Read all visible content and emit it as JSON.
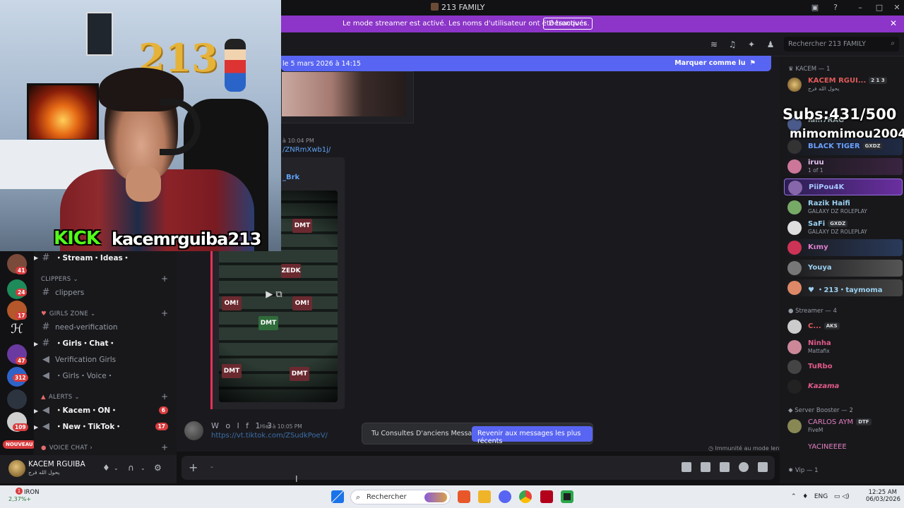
{
  "window": {
    "title": "213 FAMILY"
  },
  "banner": {
    "text": "Le mode streamer est activé. Les noms d'utilisateur ont été tronqués.",
    "button": "Désactiver"
  },
  "header": {
    "search_placeholder": "Rechercher 213 FAMILY"
  },
  "unread_bar": {
    "text": "le 5 mars 2026 à 14:15",
    "mark_read": "Marquer comme lu"
  },
  "messages": [
    {
      "timestamp": "à 10:04 PM",
      "link": "/ZNRmXwb1j/",
      "embed_author": "_Brk"
    },
    {
      "author": "W o l f 1 3",
      "timestamp": "Hier à 10:05 PM",
      "link": "https://vt.tiktok.com/ZSudkPoeV/"
    }
  ],
  "video_tiles": [
    "DMT",
    "ZEDK",
    "OM!",
    "DMT",
    "OM!",
    "DMT",
    "DMT"
  ],
  "toast": {
    "text": "Tu Consultes D'anciens Messages",
    "button": "Revenir aux messages les plus récents"
  },
  "slowmode": "Immunité au mode lent",
  "composer": {
    "placeholder": "-"
  },
  "servers": [
    {
      "badge": "41",
      "color": "#7a4a3a"
    },
    {
      "badge": "24",
      "color": "#1f8a5a"
    },
    {
      "badge": "17",
      "color": "#b4572a"
    },
    {
      "badge": "",
      "color": "#1c1c1c"
    },
    {
      "badge": "47",
      "color": "#6a3aa0"
    },
    {
      "badge": "312",
      "color": "#2f63c8"
    },
    {
      "badge": "",
      "color": "#2c3440"
    },
    {
      "badge": "109",
      "color": "#d0d0d0"
    }
  ],
  "nouveau": "NOUVEAU",
  "channels": {
    "stream_ideas": "・Stream・Ideas・",
    "cat_clippers": "CLIPPERS",
    "clippers": "clippers",
    "cat_girls": "GIRLS ZONE",
    "need_verification": "need-verification",
    "girls_chat": "・Girls・Chat・",
    "verification_girls": "Verification Girls",
    "girls_voice": "・Girls・Voice・",
    "cat_alerts": "ALERTS",
    "kacem_on": "・Kacem・ON・",
    "kacem_on_badge": "6",
    "new_tiktok": "・New・TikTok・",
    "new_tiktok_badge": "17",
    "cat_voice": "VOICE CHAT"
  },
  "user": {
    "name": "KACEM RGUIBA",
    "subtitle": "يحول الله فرج"
  },
  "members": {
    "group_kacem": "KACEM — 1",
    "kacem_name": "KACEM RGUI...",
    "kacem_tag": "2 1 3",
    "kacem_sub": "يحول الله فرج",
    "iam7rag": "iam7RAG",
    "black_tiger": "BLACK TIGER",
    "black_tiger_tag": "GXDZ",
    "iruu": "iruu",
    "iruu_sub": "1 of 1",
    "piipou": "PiiPou4K",
    "razik": "Razik Haifi",
    "razik_sub": "GALAXY DZ ROLEPLAY",
    "safi": "SaFi",
    "safi_tag": "GXDZ",
    "safi_sub": "GALAXY DZ ROLEPLAY",
    "kimy": "Kιmy",
    "youya": "Youya",
    "taymoma": "・213・taymoma",
    "group_streamer": "Streamer — 4",
    "c_name": "C...",
    "c_tag": "AKS",
    "ninha": "Ninha",
    "ninha_sub": "Mattafix",
    "turbo": "TuRbo",
    "kazama": "Kazama",
    "group_booster": "Server Booster — 2",
    "carlos": "CARLOS AYM",
    "carlos_tag": "DTF",
    "carlos_sub": "FiveM",
    "yacine": "YACINEEEE",
    "group_vip": "Vip — 1"
  },
  "overlay": {
    "subs": "Subs:431/500",
    "donor": "mimomimou2004"
  },
  "stream": {
    "platform": "KICK",
    "channel": "kacemrguiba213"
  },
  "taskbar": {
    "weather_title": "IRON",
    "weather_sub": "2,37%+",
    "weather_badge": "1",
    "search": "Rechercher",
    "lang": "ENG",
    "time": "12:25 AM",
    "date": "06/03/2026"
  }
}
